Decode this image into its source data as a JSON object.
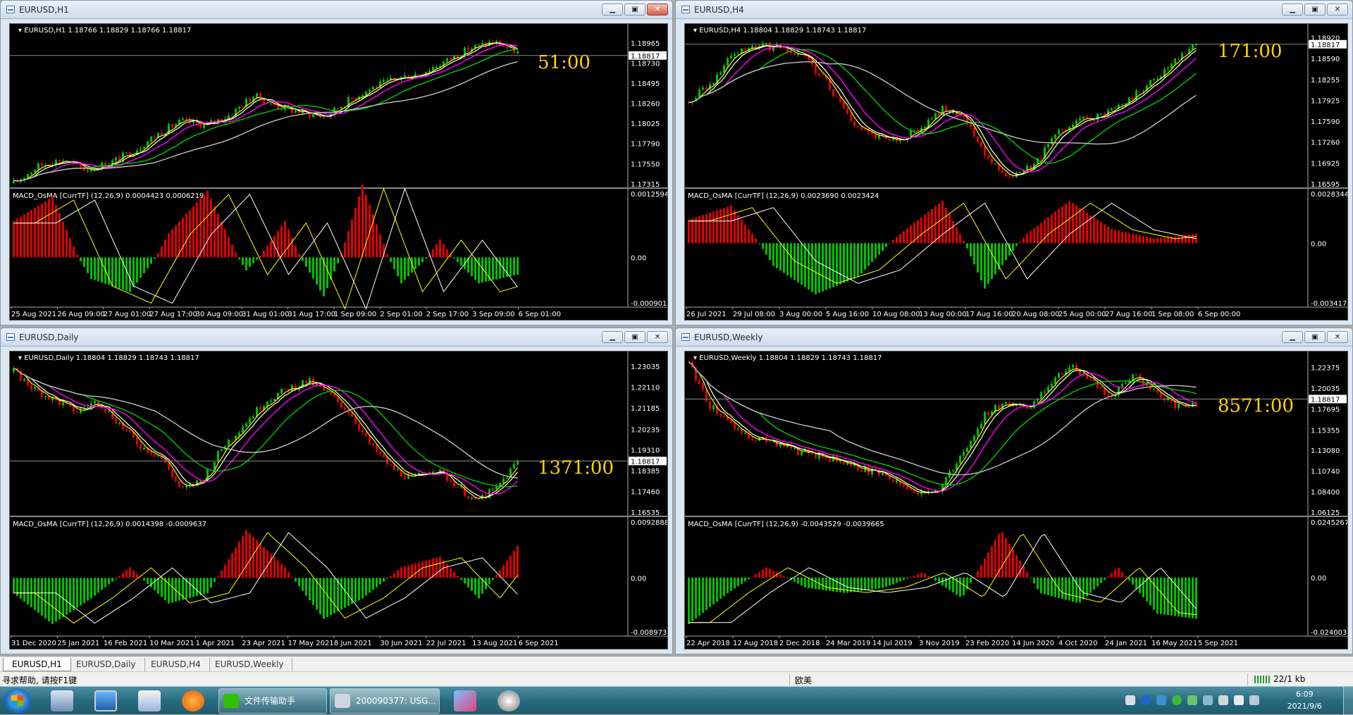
{
  "charts": [
    {
      "id": "h1",
      "window_title": "EURUSD,H1",
      "info": "EURUSD,H1  1.18766 1.18829 1.18766 1.18817",
      "osc_info": "MACD_OsMA [CurrTF] (12,26,9) 0.0004423 0.0006219",
      "countdown": "51:00",
      "current_price": "1.18817",
      "price_labels": [
        "1.18965",
        "1.18730",
        "1.18495",
        "1.18260",
        "1.18025",
        "1.17790",
        "1.17550",
        "1.17315"
      ],
      "osc_labels": [
        "0.0012594",
        "0.00",
        "-0.000901"
      ],
      "time_labels": [
        "25 Aug 2021",
        "26 Aug 09:00",
        "27 Aug 01:00",
        "27 Aug 17:00",
        "30 Aug 09:00",
        "31 Aug 01:00",
        "31 Aug 17:00",
        "1 Sep 09:00",
        "2 Sep 01:00",
        "2 Sep 17:00",
        "3 Sep 09:00",
        "6 Sep 01:00"
      ],
      "close_active": true,
      "chart_data": {
        "type": "candlestick",
        "symbol": "EURUSD",
        "timeframe": "H1",
        "ylim": [
          1.17315,
          1.1912
        ],
        "price_path": [
          1.1732,
          1.1752,
          1.176,
          1.1748,
          1.1756,
          1.177,
          1.179,
          1.1805,
          1.18,
          1.1812,
          1.1835,
          1.1822,
          1.1815,
          1.181,
          1.183,
          1.1845,
          1.1855,
          1.1862,
          1.1875,
          1.189,
          1.1898,
          1.1885
        ],
        "moving_averages": [
          "yellow",
          "white",
          "magenta",
          "green",
          "silver"
        ],
        "macd_hist_path": [
          0.6,
          1,
          -0.5,
          -0.8,
          0.4,
          1.1,
          -0.3,
          0.6,
          -0.9,
          1.2,
          -0.6,
          0.3,
          -0.6,
          -0.4
        ],
        "osc_ylim": [
          -0.000901,
          0.0012594
        ]
      }
    },
    {
      "id": "h4",
      "window_title": "EURUSD,H4",
      "info": "EURUSD,H4  1.18804 1.18829 1.18743 1.18817",
      "osc_info": "MACD_OsMA [CurrTF] (12,26,9) 0.0023690 0.0023424",
      "countdown": "171:00",
      "current_price": "1.18817",
      "price_labels": [
        "1.18920",
        "1.18590",
        "1.18255",
        "1.17925",
        "1.17590",
        "1.17260",
        "1.16925",
        "1.16595"
      ],
      "osc_labels": [
        "0.0028344",
        "0.00",
        "-0.003417"
      ],
      "time_labels": [
        "26 Jul 2021",
        "29 Jul 08:00",
        "3 Aug 00:00",
        "5 Aug 16:00",
        "10 Aug 08:00",
        "13 Aug 00:00",
        "17 Aug 16:00",
        "20 Aug 08:00",
        "25 Aug 00:00",
        "27 Aug 16:00",
        "1 Sep 08:00",
        "6 Sep 00:00"
      ],
      "close_active": false,
      "chart_data": {
        "type": "candlestick",
        "symbol": "EURUSD",
        "timeframe": "H4",
        "ylim": [
          1.16595,
          1.1905
        ],
        "price_path": [
          1.179,
          1.182,
          1.187,
          1.188,
          1.1875,
          1.186,
          1.182,
          1.176,
          1.1735,
          1.173,
          1.1745,
          1.178,
          1.176,
          1.17,
          1.167,
          1.169,
          1.174,
          1.176,
          1.177,
          1.179,
          1.182,
          1.185,
          1.1885
        ],
        "moving_averages": [
          "yellow",
          "white",
          "magenta",
          "green",
          "silver"
        ],
        "macd_hist_path": [
          0.5,
          0.8,
          -0.4,
          -0.9,
          -0.6,
          0.2,
          0.9,
          -0.8,
          0.2,
          0.9,
          0.3,
          0.1,
          0.2
        ],
        "osc_ylim": [
          -0.003417,
          0.0028344
        ]
      }
    },
    {
      "id": "d1",
      "window_title": "EURUSD,Daily",
      "info": "EURUSD,Daily  1.18804 1.18829 1.18743 1.18817",
      "osc_info": "MACD_OsMA [CurrTF] (12,26,9) 0.0014398 -0.0009637",
      "countdown": "1371:00",
      "current_price": "1.18817",
      "price_labels": [
        "1.23035",
        "1.22110",
        "1.21185",
        "1.20235",
        "1.19310",
        "1.18385",
        "1.17460",
        "1.16535"
      ],
      "osc_labels": [
        "0.0092888",
        "0.00",
        "-0.008973"
      ],
      "time_labels": [
        "31 Dec 2020",
        "25 Jan 2021",
        "16 Feb 2021",
        "10 Mar 2021",
        "1 Apr 2021",
        "23 Apr 2021",
        "17 May 2021",
        "8 Jun 2021",
        "30 Jun 2021",
        "22 Jul 2021",
        "13 Aug 2021",
        "6 Sep 2021"
      ],
      "close_active": false,
      "chart_data": {
        "type": "candlestick",
        "symbol": "EURUSD",
        "timeframe": "Daily",
        "ylim": [
          1.16535,
          1.2345
        ],
        "price_path": [
          1.228,
          1.22,
          1.215,
          1.21,
          1.215,
          1.205,
          1.195,
          1.19,
          1.175,
          1.18,
          1.195,
          1.205,
          1.215,
          1.22,
          1.224,
          1.218,
          1.21,
          1.195,
          1.185,
          1.18,
          1.185,
          1.178,
          1.17,
          1.176,
          1.188
        ],
        "moving_averages": [
          "yellow",
          "white",
          "magenta",
          "green",
          "silver"
        ],
        "macd_hist_path": [
          -0.3,
          -0.9,
          -0.4,
          0.2,
          -0.5,
          -0.3,
          0.9,
          0.2,
          -0.8,
          -0.4,
          0.2,
          0.4,
          -0.4,
          0.6
        ],
        "osc_ylim": [
          -0.008973,
          0.0092888
        ]
      }
    },
    {
      "id": "w1",
      "window_title": "EURUSD,Weekly",
      "info": "EURUSD,Weekly  1.18804 1.18829 1.18743 1.18817",
      "osc_info": "MACD_OsMA [CurrTF] (12,26,9) -0.0043529 -0.0039665",
      "countdown": "8571:00",
      "current_price": "1.18817",
      "price_labels": [
        "1.22375",
        "1.20035",
        "1.17695",
        "1.15355",
        "1.13080",
        "1.10740",
        "1.08400",
        "1.06125"
      ],
      "osc_labels": [
        "0.0245267",
        "0.00",
        "-0.024003"
      ],
      "time_labels": [
        "22 Apr 2018",
        "12 Aug 2018",
        "2 Dec 2018",
        "24 Mar 2019",
        "14 Jul 2019",
        "3 Nov 2019",
        "23 Feb 2020",
        "14 Jun 2020",
        "4 Oct 2020",
        "24 Jan 2021",
        "16 May 2021",
        "5 Sep 2021"
      ],
      "close_active": false,
      "chart_data": {
        "type": "candlestick",
        "symbol": "EURUSD",
        "timeframe": "Weekly",
        "ylim": [
          1.06125,
          1.2352
        ],
        "price_path": [
          1.23,
          1.18,
          1.16,
          1.145,
          1.14,
          1.13,
          1.125,
          1.12,
          1.11,
          1.105,
          1.095,
          1.08,
          1.09,
          1.13,
          1.17,
          1.185,
          1.175,
          1.205,
          1.225,
          1.21,
          1.19,
          1.215,
          1.2,
          1.18,
          1.185
        ],
        "moving_averages": [
          "yellow",
          "white",
          "magenta",
          "green",
          "silver"
        ],
        "macd_hist_path": [
          -0.9,
          -0.3,
          0.2,
          -0.2,
          -0.3,
          -0.2,
          0.1,
          -0.4,
          0.9,
          -0.3,
          -0.5,
          0.2,
          -0.7,
          -0.8
        ],
        "osc_ylim": [
          -0.024003,
          0.0245267
        ]
      }
    }
  ],
  "tabs": [
    "EURUSD,H1",
    "EURUSD,Daily",
    "EURUSD,H4",
    "EURUSD,Weekly"
  ],
  "status": {
    "help": "寻求帮助, 请按F1键",
    "profile": "欧美",
    "traffic": "22/1 kb"
  },
  "taskbar": {
    "wechat": "文件传输助手",
    "terminal": "200090377: USG...",
    "time": "6:09",
    "date": "2021/9/6"
  },
  "colors": {
    "bull": "#00c000",
    "bear": "#e00000",
    "ma_yellow": "#ffff00",
    "ma_white": "#ffffff",
    "ma_magenta": "#ff00ff",
    "ma_green": "#00cc00",
    "ma_silver": "#c0c0c0",
    "countdown": "#ffd400"
  }
}
